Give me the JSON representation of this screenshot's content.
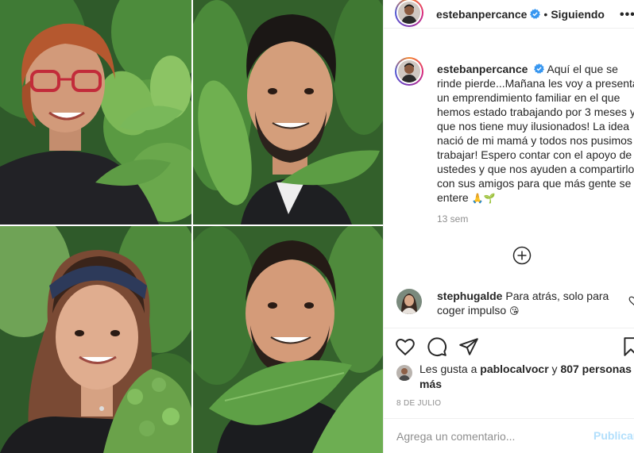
{
  "post": {
    "author": "estebanpercance",
    "follow_status": "Siguiendo",
    "separator": "•",
    "more_label": "•••",
    "caption": "Aquí el que se rinde pierde...Mañana les voy a presentar un emprendimiento familiar en el que hemos estado trabajando por 3 meses y que nos tiene muy ilusionados! La idea nació de mi mamá y todos nos pusimos a trabajar! Espero contar con el apoyo de ustedes y que nos ayuden a compartirlo con sus amigos para que más gente se entere",
    "caption_emoji": "🙏🌱",
    "time_ago": "13 sem"
  },
  "comments": [
    {
      "user": "stephugalde",
      "text": "Para atrás, solo para coger impulso",
      "emoji": "😘"
    }
  ],
  "likes": {
    "prefix": "Les gusta a",
    "user": "pablocalvocr",
    "conj": "y",
    "others": "807 personas más"
  },
  "date": "8 DE JULIO",
  "add_comment": {
    "placeholder": "Agrega un comentario...",
    "publish_label": "Publicar"
  },
  "icons": {
    "verified": "verified-badge-icon",
    "load_more": "plus-circle-icon",
    "like": "heart-icon",
    "comment": "comment-bubble-icon",
    "share": "paper-plane-icon",
    "save": "bookmark-icon"
  },
  "colors": {
    "verified_blue": "#3897f0",
    "publish_disabled": "#b2dffc",
    "muted_text": "#8e8e8e"
  }
}
